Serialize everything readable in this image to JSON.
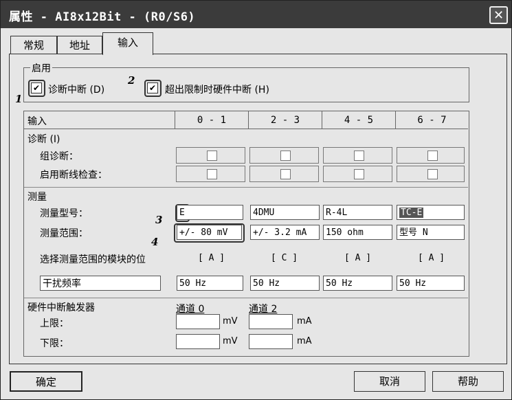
{
  "window": {
    "title": "属性 - AI8x12Bit - (R0/S6)",
    "close_glyph": "✕"
  },
  "tabs": [
    {
      "label": "常规"
    },
    {
      "label": "地址"
    },
    {
      "label": "输入"
    }
  ],
  "enable_group": {
    "legend": "启用",
    "diag_interrupt": {
      "label": "诊断中断 (D)",
      "checked": true,
      "callout": "1"
    },
    "hw_interrupt": {
      "label": "超出限制时硬件中断 (H)",
      "checked": true,
      "callout": "2"
    }
  },
  "table": {
    "header_label": "输入",
    "channels": [
      "0 - 1",
      "2 - 3",
      "4 - 5",
      "6 - 7"
    ],
    "diagnostics": {
      "title": "诊断 (I)",
      "group_diag_label": "组诊断：",
      "wire_break_label": "启用断线检查："
    },
    "measure": {
      "title": "测量",
      "type_label": "测量型号：",
      "range_label": "测量范围：",
      "types": [
        "E",
        "4DMU",
        "R-4L",
        "TC-E"
      ],
      "ranges": [
        "+/- 80 mV",
        "+/- 3.2 mA",
        "150 ohm",
        "型号 N"
      ],
      "module_pos_label": "选择测量范围的模块的位",
      "module_positions": [
        "[ A ]",
        "[ C ]",
        "[ A ]",
        "[ A ]"
      ],
      "interference_label": "干扰频率",
      "interference": [
        "50 Hz",
        "50 Hz",
        "50 Hz",
        "50 Hz"
      ],
      "callout_type": "3",
      "callout_range": "4"
    },
    "hw_trigger": {
      "title": "硬件中断触发器",
      "channel0": "通道 0",
      "channel2": "通道 2",
      "upper_label": "上限：",
      "lower_label": "下限：",
      "unit0": "mV",
      "unit2": "mA"
    }
  },
  "buttons": {
    "ok": "确定",
    "cancel": "取消",
    "help": "帮助"
  }
}
